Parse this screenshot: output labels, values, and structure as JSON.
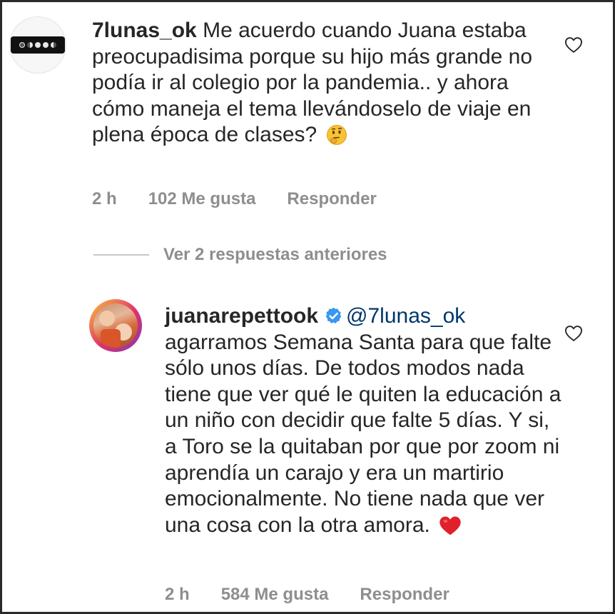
{
  "comment1": {
    "username": "7lunas_ok",
    "text": "Me acuerdo cuando Juana estaba preocupadisima porque su hijo más grande no podía ir al colegio por la pandemia.. y ahora cómo maneja el tema llevándoselo de viaje en plena época de clases?",
    "emoji": "thinking-face-emoji",
    "time": "2 h",
    "likes": "102 Me gusta",
    "reply": "Responder"
  },
  "thread": {
    "view_replies": "Ver 2 respuestas anteriores"
  },
  "comment2": {
    "username": "juanarepettook",
    "mention": "@7lunas_ok",
    "text": "agarramos Semana Santa para que falte sólo unos días. De todos modos nada tiene que ver qué le quiten la educación a un niño con decidir que falte 5 días. Y si, a Toro se la quitaban por que por zoom ni aprendía un carajo y era un martirio emocionalmente. No tiene nada que ver una cosa con la otra amora.",
    "emoji": "red-heart-emoji",
    "time": "2 h",
    "likes": "584 Me gusta",
    "reply": "Responder"
  },
  "colors": {
    "text": "#262626",
    "meta": "#8e8e8e",
    "mention": "#00376b",
    "verified": "#3897f0",
    "heart_emoji": "#e0202b"
  }
}
